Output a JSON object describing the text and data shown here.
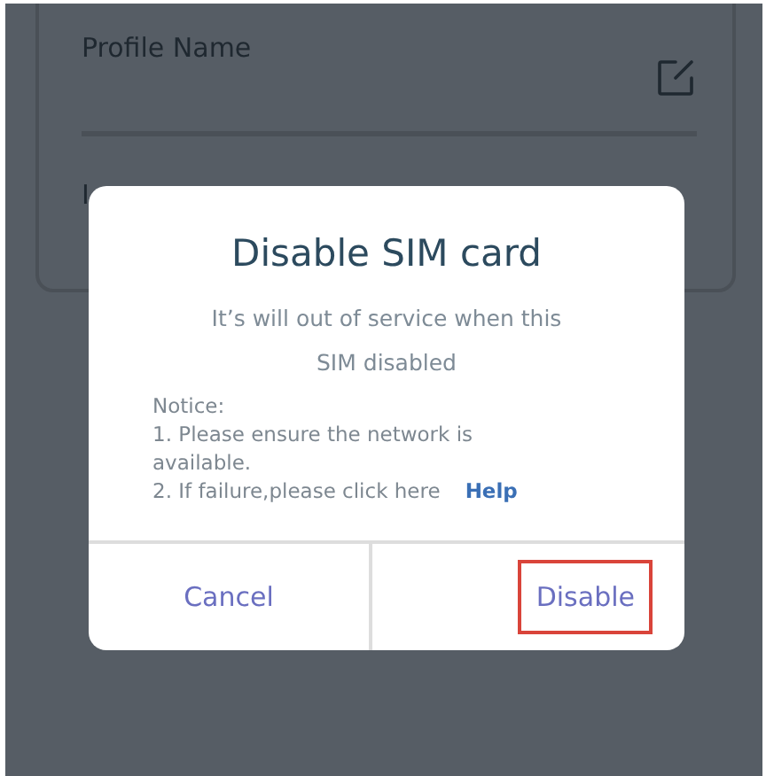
{
  "card": {
    "profile_label": "Profile Name",
    "field_label": "I"
  },
  "dialog": {
    "title": "Disable SIM card",
    "message_lines": [
      "It’s will out of service when this",
      "SIM disabled"
    ],
    "notice": {
      "title": "Notice:",
      "items": [
        "1. Please ensure the network is available.",
        "2. If failure,please click here"
      ],
      "link": "Help"
    },
    "buttons": [
      {
        "label": "Cancel",
        "highlighted": false
      },
      {
        "label": "Disable",
        "highlighted": true
      }
    ]
  }
}
